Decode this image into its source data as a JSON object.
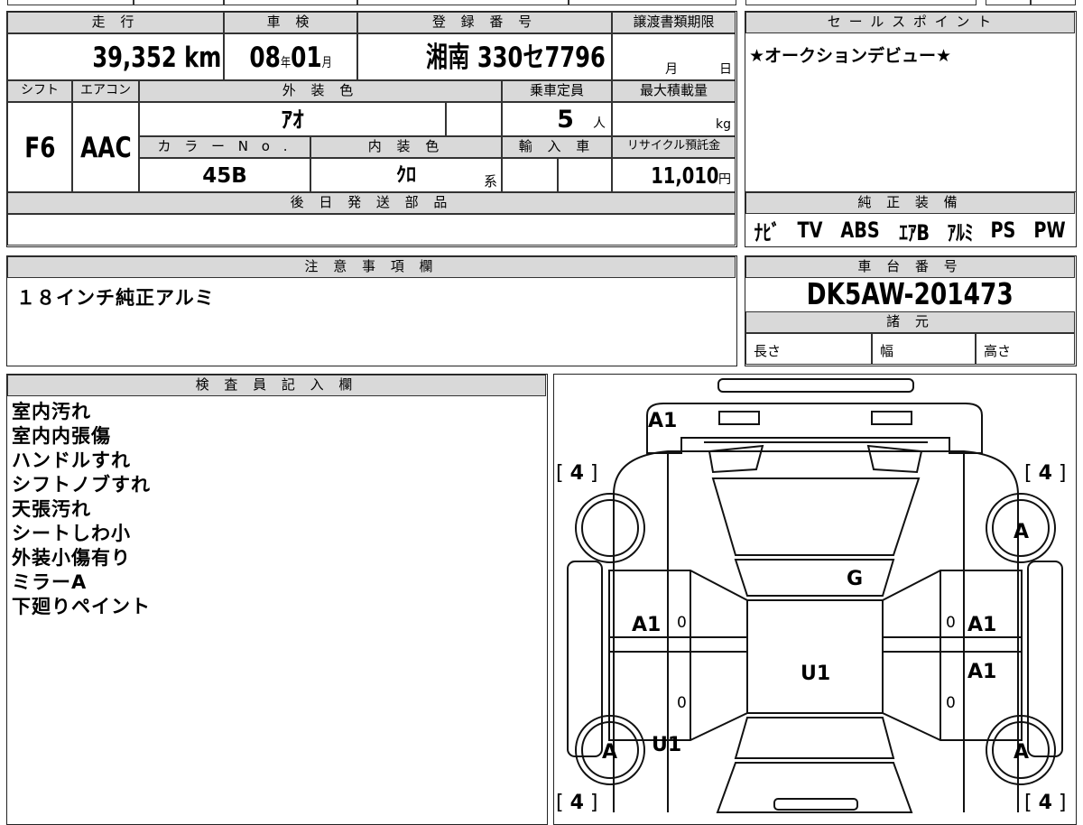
{
  "top_table": {
    "mileage": {
      "label": "走 行",
      "value": "39,352",
      "unit": "km"
    },
    "inspection": {
      "label": "車 検",
      "year": "08",
      "year_unit": "年",
      "month": "01",
      "month_unit": "月"
    },
    "registration": {
      "label": "登 録 番 号",
      "value": "湘南 330セ7796"
    },
    "transfer_deadline": {
      "label": "譲渡書類期限",
      "month_unit": "月",
      "day_unit": "日"
    },
    "shift": {
      "label": "シフト",
      "value": "F6"
    },
    "aircon": {
      "label": "エアコン",
      "value": "AAC"
    },
    "exterior_color": {
      "label": "外 装 色",
      "value": "ｱｵ"
    },
    "capacity": {
      "label": "乗車定員",
      "value": "5",
      "unit": "人"
    },
    "max_load": {
      "label": "最大積載量",
      "unit": "kg"
    },
    "color_no": {
      "label": "カ ラ ー N o .",
      "value": "45B"
    },
    "interior_color": {
      "label": "内 装 色",
      "value": "ｸﾛ",
      "suffix": "系"
    },
    "import": {
      "label": "輸 入 車"
    },
    "recycle": {
      "label": "リサイクル預託金",
      "value": "11,010",
      "unit": "円"
    },
    "later_parts": {
      "label": "後 日 発 送 部 品"
    }
  },
  "sales_point": {
    "label": "セ ー ル ス ポ イ ン ト",
    "text": "★オークションデビュー★"
  },
  "equipment": {
    "label": "純 正 装 備",
    "items": [
      "ﾅﾋﾞ",
      "TV",
      "ABS",
      "ｴｱB",
      "ｱﾙﾐ",
      "PS",
      "PW"
    ]
  },
  "notes": {
    "label": "注 意 事 項 欄",
    "text": "１８インチ純正アルミ"
  },
  "chassis": {
    "label": "車 台 番 号",
    "value": "DK5AW-201473"
  },
  "specs": {
    "label": "諸 元",
    "length": "長さ",
    "width": "幅",
    "height": "高さ"
  },
  "inspector": {
    "label": "検 査 員 記 入 欄",
    "lines": [
      "室内汚れ",
      "室内内張傷",
      "ハンドルすれ",
      "シフトノブすれ",
      "天張汚れ",
      "シートしわ小",
      "外装小傷有り",
      "ミラーA",
      "下廻りペイント"
    ]
  },
  "diagram": {
    "tread_mark": "[ 4 ]",
    "tread_value": "4",
    "front_bumper": "A1",
    "windshield": "G",
    "roof": "U1",
    "left_front_door": "A1",
    "right_front_door": "A1",
    "right_rear_door": "A1",
    "left_rear_fender": "U1",
    "right_front_wheel": "A",
    "left_rear_wheel": "A",
    "right_rear_wheel": "A",
    "zero": "0"
  }
}
